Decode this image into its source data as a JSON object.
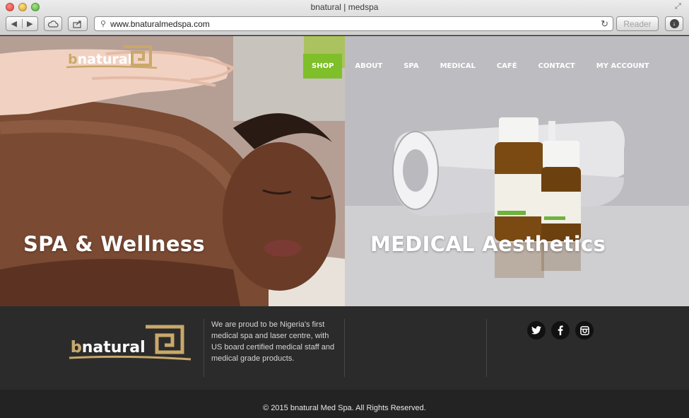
{
  "window": {
    "title": "bnatural | medspa",
    "url": "www.bnaturalmedspa.com",
    "reader_label": "Reader"
  },
  "site": {
    "logo_text": "bnatural",
    "nav": [
      {
        "label": "SHOP",
        "active": true
      },
      {
        "label": "ABOUT"
      },
      {
        "label": "SPA"
      },
      {
        "label": "MEDICAL"
      },
      {
        "label": "CAFÉ"
      },
      {
        "label": "CONTACT"
      },
      {
        "label": "MY ACCOUNT"
      }
    ],
    "accent_color": "#7fbf2a",
    "logo_color": "#c9a86a",
    "panels": {
      "spa": {
        "label": "SPA & Wellness"
      },
      "medical": {
        "label": "MEDICAL Aesthetics"
      }
    }
  },
  "footer": {
    "about": "We are proud to be Nigeria's first medical spa and laser centre, with US board certified medical staff and medical grade products.",
    "social": [
      "twitter-icon",
      "facebook-icon",
      "instagram-icon"
    ],
    "copyright": "© 2015 bnatural Med Spa. All Rights Reserved."
  }
}
